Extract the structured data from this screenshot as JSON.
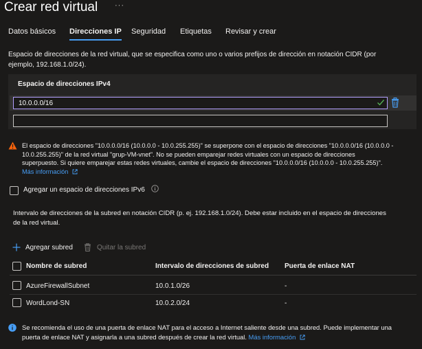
{
  "page": {
    "title": "Crear red virtual",
    "more_actions": "···"
  },
  "tabs": [
    {
      "label": "Datos básicos",
      "active": false
    },
    {
      "label": "Direcciones IP",
      "active": true
    },
    {
      "label": "Seguridad",
      "active": false
    },
    {
      "label": "Etiquetas",
      "active": false
    },
    {
      "label": "Revisar y crear",
      "active": false
    }
  ],
  "address_space": {
    "description_line1": "Espacio de direcciones de la red virtual, que se especifica como uno o varios prefijos de dirección en notación CIDR (por",
    "description_line2": "ejemplo, 192.168.1.0/24).",
    "section_label": "Espacio de direcciones IPv4",
    "ipv4_value": "10.0.0.0/16",
    "empty_value": "",
    "check_icon": "checkmark-icon",
    "delete_icon": "trash-icon"
  },
  "warning": {
    "icon": "warning-icon",
    "line1": "El espacio de direcciones \"10.0.0.0/16 (10.0.0.0 - 10.0.255.255)\" se superpone con el espacio de direcciones \"10.0.0.0/16 (10.0.0.0 -",
    "line2": "10.0.255.255)\" de la red virtual \"grup-VM-vnet\". No se pueden emparejar redes virtuales con un espacio de direcciones",
    "line3": "superpuesto. Si quiere emparejar estas redes virtuales, cambie el espacio de direcciones \"10.0.0.0/16 (10.0.0.0 - 10.0.255.255)\".",
    "link": "Más información"
  },
  "ipv6": {
    "label": "Agregar un espacio de direcciones IPv6",
    "checked": false,
    "info_icon": "info-icon"
  },
  "subnets": {
    "description_line1": "Intervalo de direcciones de la subred en notación CIDR (p. ej. 192.168.1.0/24). Debe estar incluido en el espacio de direcciones",
    "description_line2": "de la red virtual.",
    "add_label": "Agregar subred",
    "remove_label": "Quitar la subred",
    "columns": [
      "Nombre de subred",
      "Intervalo de direcciones de subred",
      "Puerta de enlace NAT"
    ],
    "rows": [
      {
        "name": "AzureFirewallSubnet",
        "range": "10.0.1.0/26",
        "nat": "-"
      },
      {
        "name": "WordLond-SN",
        "range": "10.0.2.0/24",
        "nat": "-"
      }
    ]
  },
  "footer": {
    "icon": "info-icon",
    "line1": "Se recomienda el uso de una puerta de enlace NAT para el acceso a Internet saliente desde una subred. Puede implementar una",
    "line2": "puerta de enlace NAT y asignarla a una subred después de crear la red virtual.",
    "link": "Más información"
  },
  "colors": {
    "background": "#1b1a19",
    "accent": "#479ef5",
    "input_focus": "#b4a0ff",
    "success": "#54b054",
    "warning": "#f7630c"
  }
}
